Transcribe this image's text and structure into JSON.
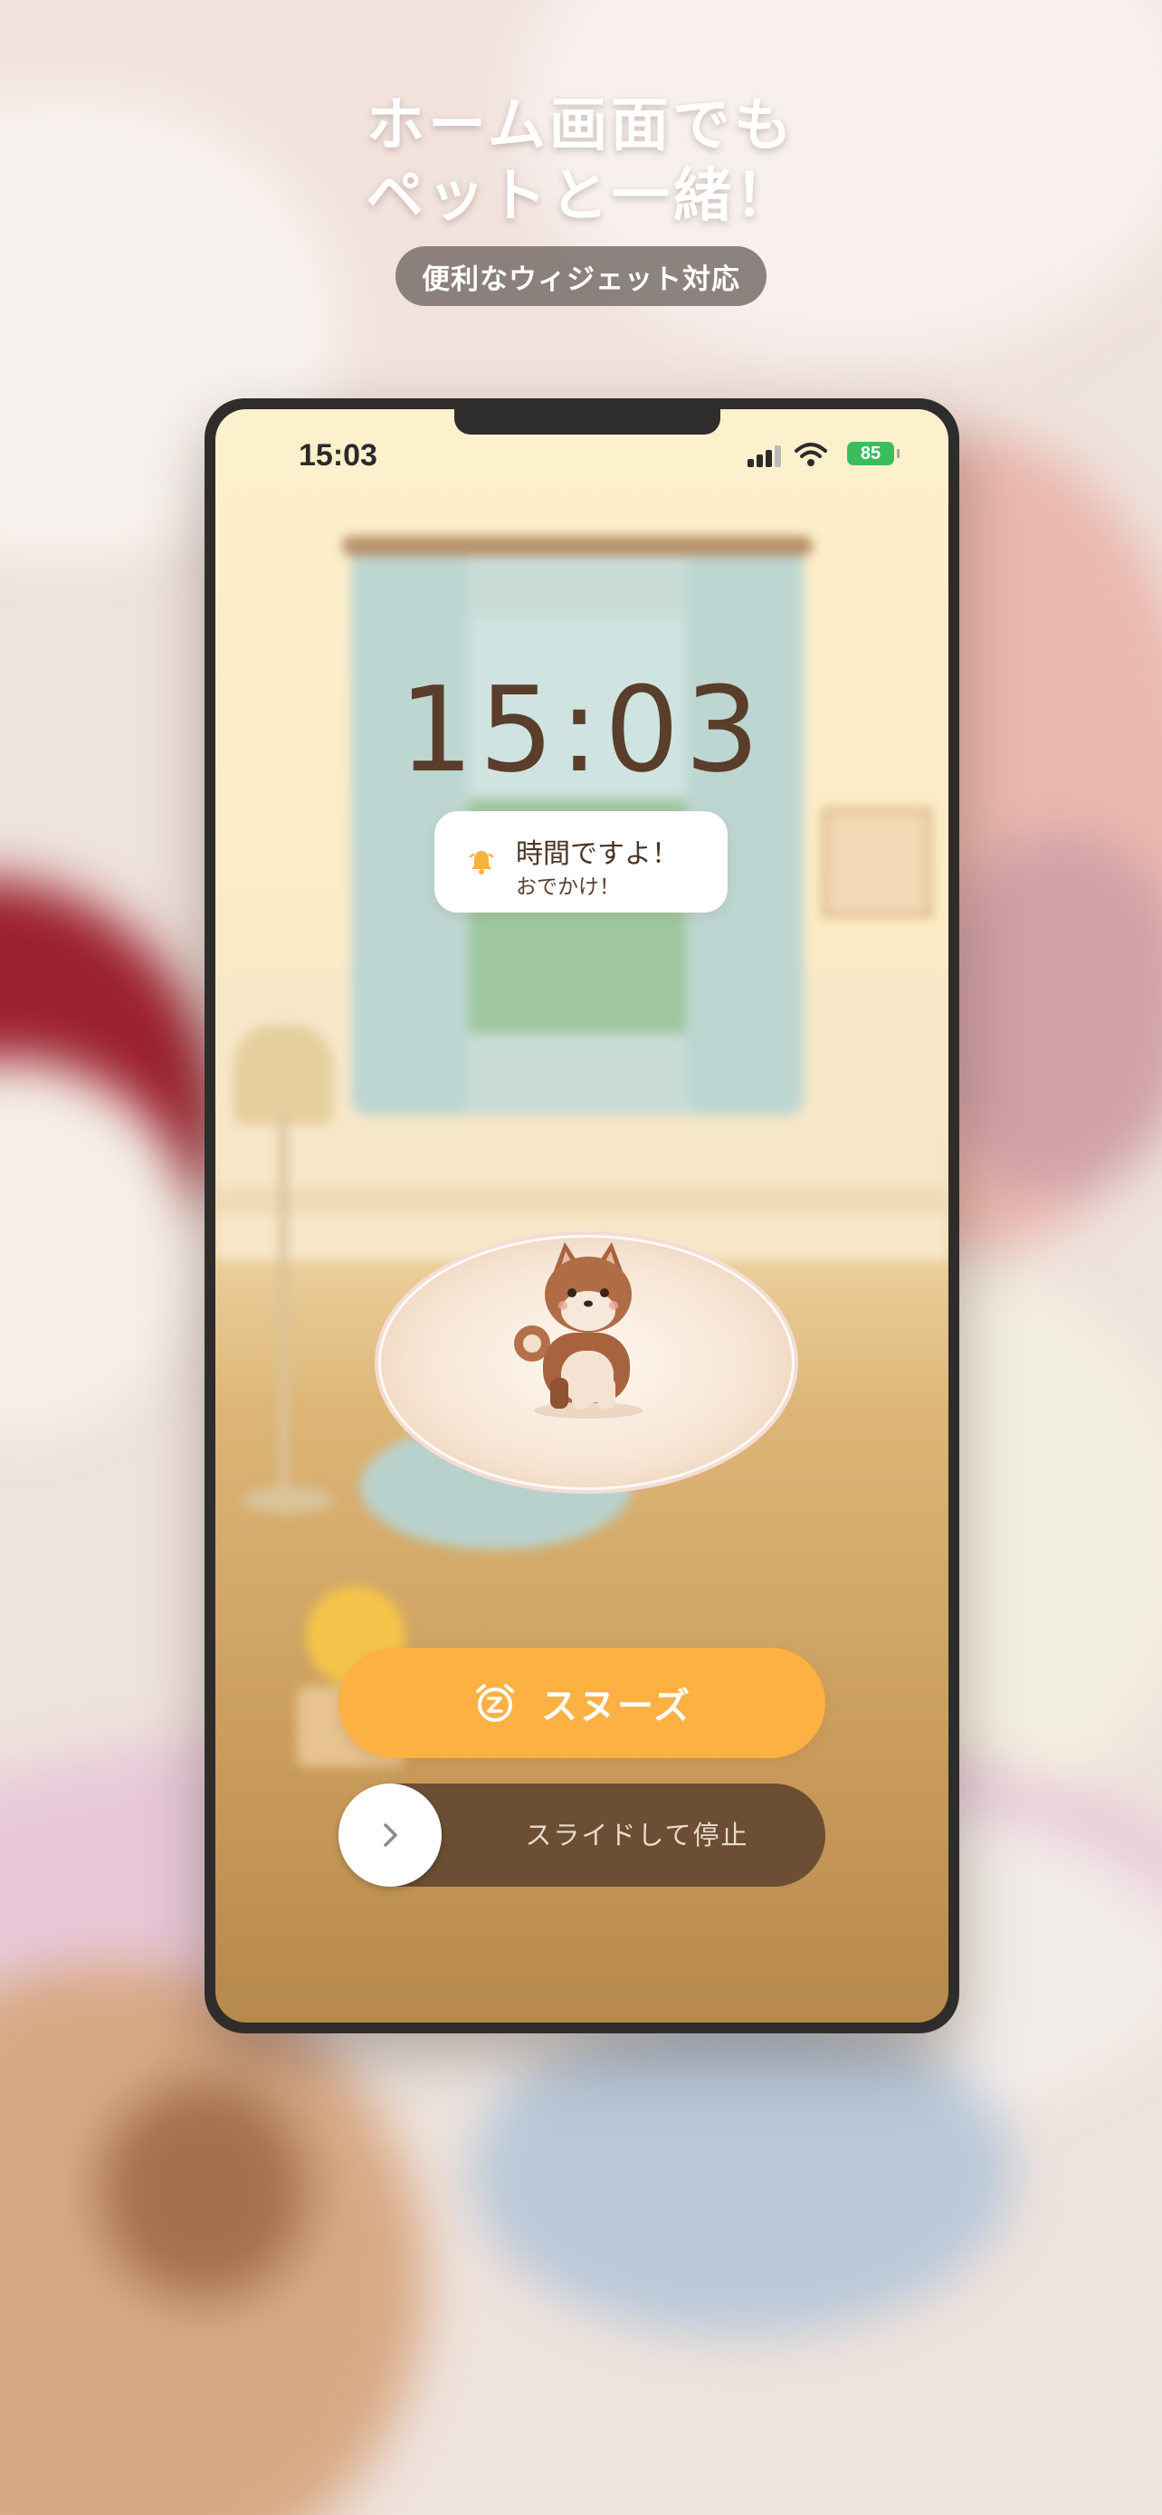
{
  "promo": {
    "headline_line1": "ホーム画面でも",
    "headline_line2": "ペットと一緒！",
    "badge": "便利なウィジェット対応"
  },
  "status_bar": {
    "time": "15:03",
    "battery": "85"
  },
  "alarm": {
    "clock": "15:03",
    "title": "時間ですよ！",
    "subtitle": "おでかけ！",
    "snooze_label": "スヌーズ",
    "slide_label": "スライドして停止"
  },
  "colors": {
    "accent": "#fdb143",
    "slider": "#6b4e33",
    "clock_text": "#5a3d2b",
    "battery": "#3bbd5e"
  },
  "icons": [
    "bell-icon",
    "alarm-clock-icon",
    "chevron-right-icon",
    "cellular-signal-icon",
    "wifi-icon",
    "battery-icon"
  ]
}
